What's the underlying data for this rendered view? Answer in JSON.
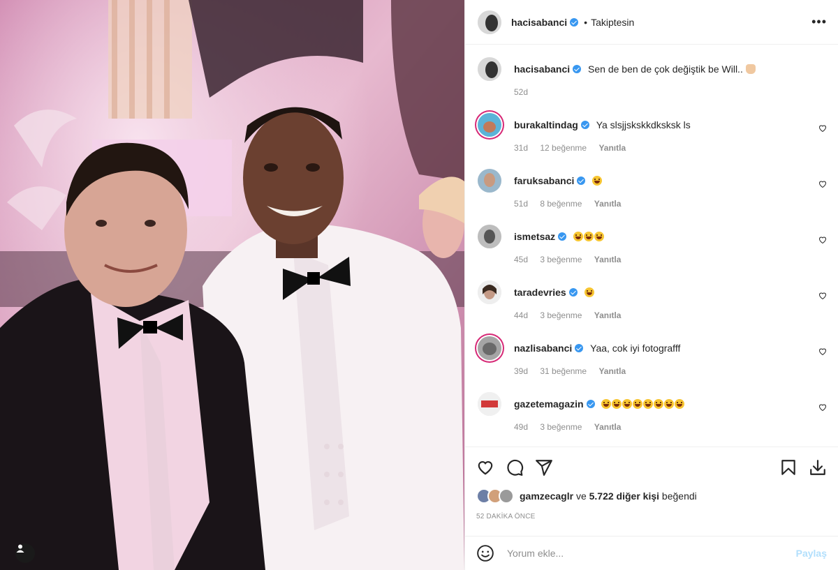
{
  "header": {
    "username": "hacisabanci",
    "separator": "•",
    "follow_status": "Takiptesin",
    "more_icon": "more-horizontal-icon"
  },
  "caption": {
    "username": "hacisabanci",
    "text": "Sen de ben de çok değiştik be Will..",
    "emoji": "waving-hand-emoji",
    "time": "52d"
  },
  "comments": [
    {
      "username": "burakaltindag",
      "text": "Ya slsjjskskkdksksk ls",
      "time": "31d",
      "likes": "12 beğenme",
      "reply": "Yanıtla",
      "avatar_ring": true
    },
    {
      "username": "faruksabanci",
      "text": "",
      "emoji_count": 1,
      "time": "51d",
      "likes": "8 beğenme",
      "reply": "Yanıtla",
      "avatar_ring": false
    },
    {
      "username": "ismetsaz",
      "text": "",
      "emoji_count": 3,
      "time": "45d",
      "likes": "3 beğenme",
      "reply": "Yanıtla",
      "avatar_ring": false
    },
    {
      "username": "taradevries",
      "text": "",
      "emoji_count": 1,
      "time": "44d",
      "likes": "3 beğenme",
      "reply": "Yanıtla",
      "avatar_ring": false
    },
    {
      "username": "nazlisabanci",
      "text": "Yaa, cok iyi fotografff",
      "time": "39d",
      "likes": "31 beğenme",
      "reply": "Yanıtla",
      "avatar_ring": true
    },
    {
      "username": "gazetemagazin",
      "text": "",
      "emoji_count": 8,
      "time": "49d",
      "likes": "3 beğenme",
      "reply": "Yanıtla",
      "avatar_ring": false
    }
  ],
  "likes": {
    "first_user": "gamzecaglr",
    "connector": "ve",
    "others": "5.722 diğer kişi",
    "suffix": "beğendi"
  },
  "post_time": "52 DAKİKA ÖNCE",
  "comment_box": {
    "placeholder": "Yorum ekle...",
    "share_label": "Paylaş"
  },
  "colors": {
    "verified": "#3897f0",
    "story_ring": "#d62976",
    "muted_text": "#8e8e8e",
    "share_disabled": "#b2dffc"
  }
}
